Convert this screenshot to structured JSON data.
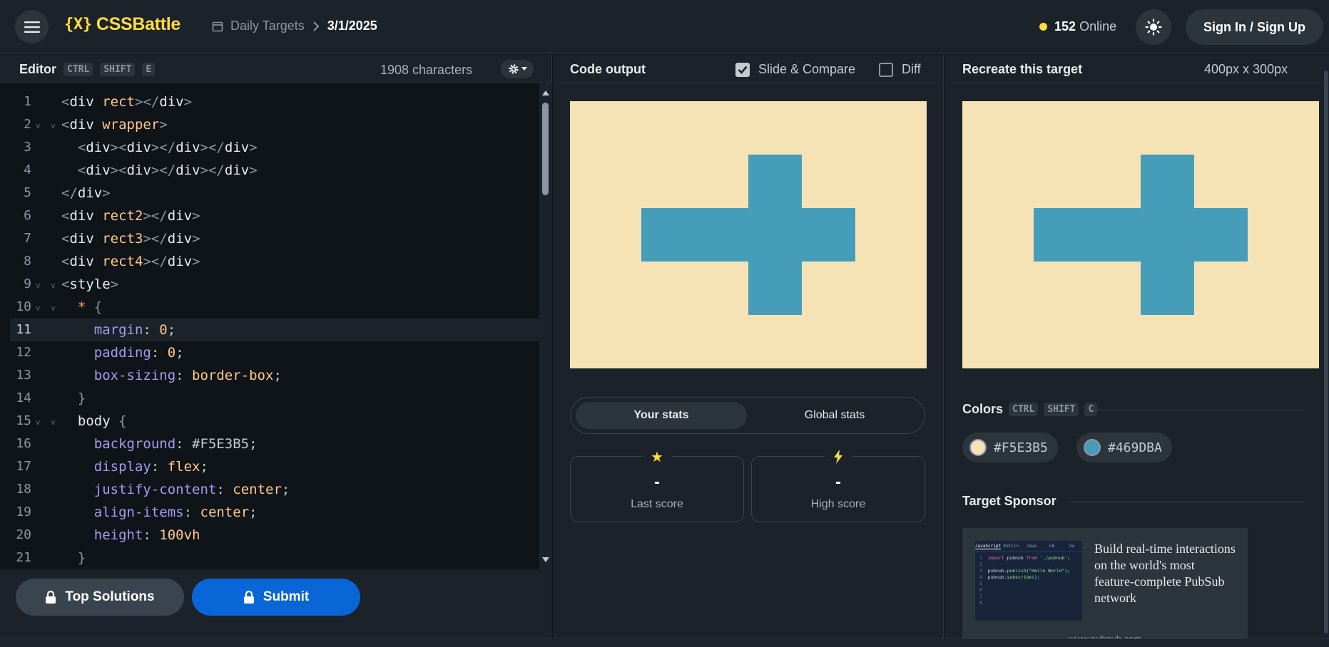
{
  "header": {
    "logo_mark": "{X}",
    "logo_text": "CSSBattle",
    "breadcrumb_section": "Daily Targets",
    "breadcrumb_current": "3/1/2025",
    "online_count": "152",
    "online_label": "Online",
    "signin_label": "Sign In / Sign Up"
  },
  "editor": {
    "title": "Editor",
    "shortcut": [
      "CTRL",
      "SHIFT",
      "E"
    ],
    "char_count": "1908 characters",
    "lines": [
      {
        "n": "1",
        "fold": false
      },
      {
        "n": "2",
        "fold": true
      },
      {
        "n": "3",
        "fold": false
      },
      {
        "n": "4",
        "fold": false
      },
      {
        "n": "5",
        "fold": false
      },
      {
        "n": "6",
        "fold": false
      },
      {
        "n": "7",
        "fold": false
      },
      {
        "n": "8",
        "fold": false
      },
      {
        "n": "9",
        "fold": true
      },
      {
        "n": "10",
        "fold": true
      },
      {
        "n": "11",
        "fold": false
      },
      {
        "n": "12",
        "fold": false
      },
      {
        "n": "13",
        "fold": false
      },
      {
        "n": "14",
        "fold": false
      },
      {
        "n": "15",
        "fold": true
      },
      {
        "n": "16",
        "fold": false
      },
      {
        "n": "17",
        "fold": false
      },
      {
        "n": "18",
        "fold": false
      },
      {
        "n": "19",
        "fold": false
      },
      {
        "n": "20",
        "fold": false
      },
      {
        "n": "21",
        "fold": false
      }
    ],
    "code": {
      "l1_tag": "div",
      "l1_attr": "rect",
      "l2_tag": "div",
      "l2_attr": "wrapper",
      "l3_text": "div",
      "l5_tag": "div",
      "l6_attr": "rect2",
      "l7_attr": "rect3",
      "l8_attr": "rect4",
      "l9_tag": "style",
      "l10_sel": "*",
      "l11_prop": "margin",
      "l11_val": "0",
      "l12_prop": "padding",
      "l12_val": "0",
      "l13_prop": "box-sizing",
      "l13_val": "border-box",
      "l15_sel": "body",
      "l16_prop": "background",
      "l16_val": "#F5E3B5",
      "l17_prop": "display",
      "l17_val": "flex",
      "l18_prop": "justify-content",
      "l18_val": "center",
      "l19_prop": "align-items",
      "l19_val": "center",
      "l20_prop": "height",
      "l20_num": "100",
      "l20_unit": "vh"
    },
    "top_solutions_label": "Top Solutions",
    "submit_label": "Submit"
  },
  "output": {
    "title": "Code output",
    "slide_compare_label": "Slide & Compare",
    "slide_compare_checked": true,
    "diff_label": "Diff",
    "diff_checked": false,
    "tab_yours": "Your stats",
    "tab_global": "Global stats",
    "last_score_value": "-",
    "last_score_label": "Last score",
    "high_score_value": "-",
    "high_score_label": "High score"
  },
  "target": {
    "title": "Recreate this target",
    "size": "400px x 300px",
    "colors_title": "Colors",
    "colors_shortcut": [
      "CTRL",
      "SHIFT",
      "C"
    ],
    "colors": [
      "#F5E3B5",
      "#469DBA"
    ],
    "sponsor_title": "Target Sponsor",
    "sponsor_text": "Build real-time interactions on the world's most feature-complete PubSub network",
    "sponsor_url": "www.pubnub.com",
    "sponsor_tabs": [
      "JavaScript",
      "Kotlin",
      "Java",
      "C#",
      "Go"
    ],
    "sponsor_code": [
      "import pubnub from './pubnub';",
      "",
      "pubnub.publish(\"Hello World\");",
      "pubnub.subscribe();"
    ]
  },
  "palette": {
    "bg": "#F5E3B5",
    "shape": "#469DBA",
    "accent": "#FFDD40",
    "submit": "#0866D6"
  },
  "icons": [
    "hamburger-menu-icon",
    "calendar-icon",
    "chevron-right-icon",
    "sun-icon",
    "gear-icon",
    "lock-icon",
    "star-icon",
    "lightning-icon",
    "checkbox-icon"
  ]
}
